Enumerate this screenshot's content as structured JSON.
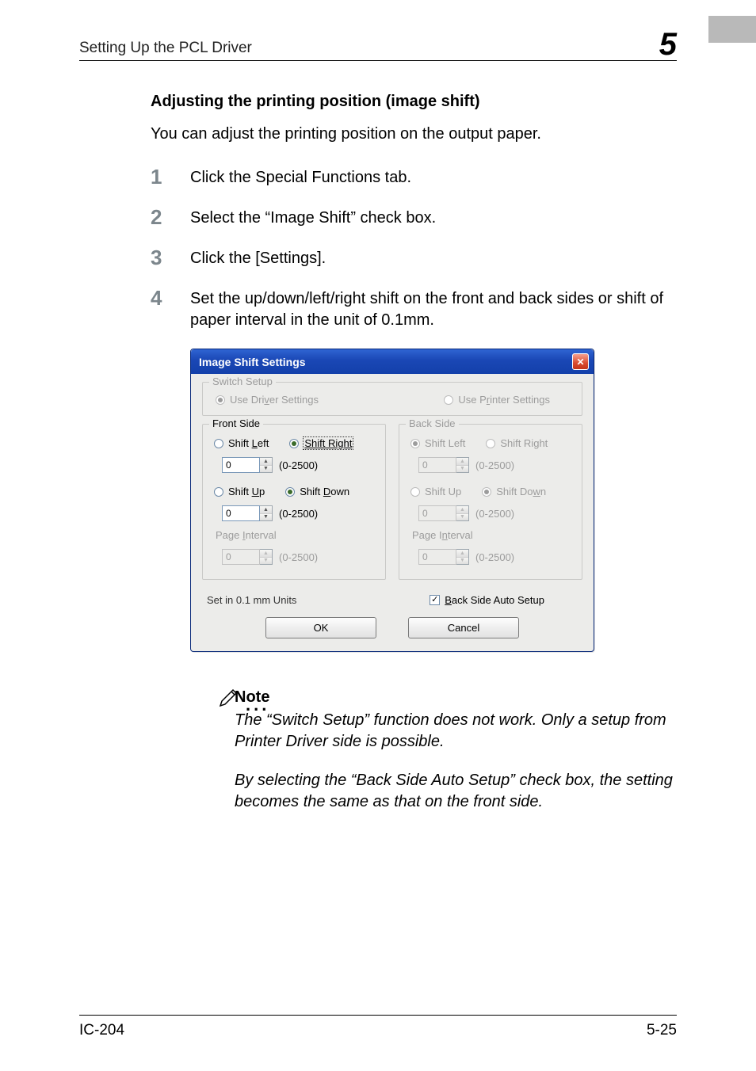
{
  "header": {
    "running_title": "Setting Up the PCL Driver",
    "chapter_number": "5"
  },
  "section": {
    "heading": "Adjusting the printing position (image shift)",
    "intro": "You can adjust the printing position on the output paper."
  },
  "steps": [
    {
      "num": "1",
      "text": "Click the Special Functions tab."
    },
    {
      "num": "2",
      "text": "Select the “Image Shift” check box."
    },
    {
      "num": "3",
      "text": "Click the [Settings]."
    },
    {
      "num": "4",
      "text": "Set the up/down/left/right shift on the front and back sides or shift of paper interval in the unit of 0.1mm."
    }
  ],
  "dialog": {
    "title": "Image Shift Settings",
    "close_glyph": "✕",
    "switch_setup": {
      "legend": "Switch Setup",
      "driver_label_pre": "Use Dri",
      "driver_label_u": "v",
      "driver_label_post": "er Settings",
      "printer_label_pre": "Use P",
      "printer_label_u": "r",
      "printer_label_post": "inter Settings"
    },
    "front": {
      "legend": "Front Side",
      "left_pre": "Shift ",
      "left_u": "L",
      "left_post": "eft",
      "right_pre": "S",
      "right_u": "h",
      "right_post": "ift Right",
      "h_value": "0",
      "h_range": "(0-2500)",
      "up_pre": "Shift ",
      "up_u": "U",
      "up_post": "p",
      "down_pre": "Shift ",
      "down_u": "D",
      "down_post": "own",
      "v_value": "0",
      "v_range": "(0-2500)",
      "page_interval_pre": "Page ",
      "page_interval_u": "I",
      "page_interval_post": "nterval",
      "pi_value": "0",
      "pi_range": "(0-2500)"
    },
    "back": {
      "legend": "Back Side",
      "left": "Shift Left",
      "right": "Shift Right",
      "h_value": "0",
      "h_range": "(0-2500)",
      "up": "Shift Up",
      "down_pre": "Shift Do",
      "down_u": "w",
      "down_post": "n",
      "v_value": "0",
      "v_range": "(0-2500)",
      "page_interval_pre": "Page I",
      "page_interval_u": "n",
      "page_interval_post": "terval",
      "pi_value": "0",
      "pi_range": "(0-2500)"
    },
    "units_note": "Set in 0.1 mm Units",
    "auto_checkbox_pre": "",
    "auto_checkbox_u": "B",
    "auto_checkbox_post": "ack Side Auto Setup",
    "check_glyph": "✓",
    "ok": "OK",
    "cancel": "Cancel",
    "spin_up": "▲",
    "spin_down": "▼"
  },
  "note": {
    "heading": "Note",
    "para1": "The “Switch Setup” function does not work. Only a setup from Printer Driver side is possible.",
    "para2": "By selecting the “Back Side Auto Setup” check box, the setting becomes the same as that on the front side."
  },
  "footer": {
    "left": "IC-204",
    "right": "5-25"
  }
}
